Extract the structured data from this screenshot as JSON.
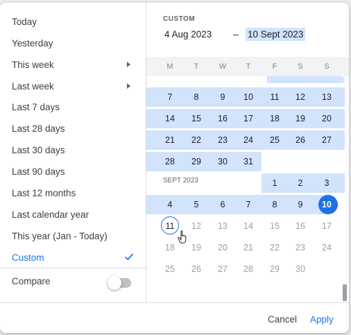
{
  "presets": [
    {
      "label": "Today",
      "submenu": false
    },
    {
      "label": "Yesterday",
      "submenu": false
    },
    {
      "label": "This week",
      "submenu": true
    },
    {
      "label": "Last week",
      "submenu": true
    },
    {
      "label": "Last 7 days",
      "submenu": false
    },
    {
      "label": "Last 28 days",
      "submenu": false
    },
    {
      "label": "Last 30 days",
      "submenu": false
    },
    {
      "label": "Last 90 days",
      "submenu": false
    },
    {
      "label": "Last 12 months",
      "submenu": false
    },
    {
      "label": "Last calendar year",
      "submenu": false
    },
    {
      "label": "This year (Jan - Today)",
      "submenu": false
    },
    {
      "label": "Custom",
      "submenu": false,
      "selected": true
    }
  ],
  "compare": {
    "label": "Compare",
    "enabled": false
  },
  "range": {
    "caption": "CUSTOM",
    "start": "4 Aug 2023",
    "separator": "–",
    "end": "10 Sept 2023"
  },
  "weekdays": [
    "M",
    "T",
    "W",
    "T",
    "F",
    "S",
    "S"
  ],
  "calendar": {
    "aug_rows": [
      [
        "7",
        "8",
        "9",
        "10",
        "11",
        "12",
        "13"
      ],
      [
        "14",
        "15",
        "16",
        "17",
        "18",
        "19",
        "20"
      ],
      [
        "21",
        "22",
        "23",
        "24",
        "25",
        "26",
        "27"
      ],
      [
        "28",
        "29",
        "30",
        "31"
      ]
    ],
    "sept_label": "SEPT 2023",
    "sept_first": [
      "1",
      "2",
      "3"
    ],
    "sept_rows": [
      [
        "4",
        "5",
        "6",
        "7",
        "8",
        "9",
        "10"
      ],
      [
        "11",
        "12",
        "13",
        "14",
        "15",
        "16",
        "17"
      ],
      [
        "18",
        "19",
        "20",
        "21",
        "22",
        "23",
        "24"
      ],
      [
        "25",
        "26",
        "27",
        "28",
        "29",
        "30"
      ]
    ]
  },
  "footer": {
    "cancel": "Cancel",
    "apply": "Apply"
  },
  "colors": {
    "accent": "#1a73e8",
    "range_fill": "#d2e3fc"
  }
}
